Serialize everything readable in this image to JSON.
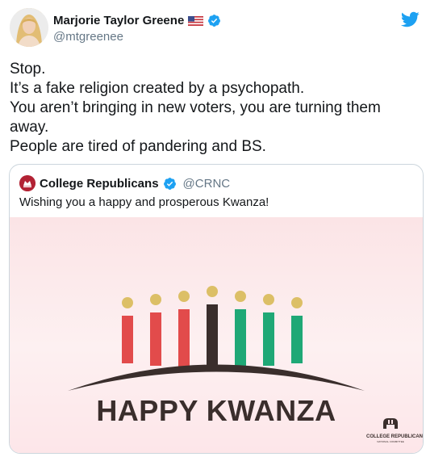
{
  "user": {
    "display_name": "Marjorie Taylor Greene",
    "handle": "@mtgreenee",
    "flag_icon": "us-flag-icon",
    "verified_icon": "verified-badge-icon",
    "verified_color": "#1da1f2"
  },
  "brand": {
    "icon": "twitter-bird-icon",
    "color": "#1da1f2"
  },
  "tweet": {
    "lines": [
      "Stop.",
      "It’s a fake religion created by a psychopath.",
      "You aren’t bringing in new voters, you are turning them away.",
      "People are tired of pandering and BS."
    ]
  },
  "quoted": {
    "display_name": "College Republicans",
    "handle": "@CRNC",
    "text": "Wishing you a happy and prosperous Kwanza!",
    "image": {
      "headline": "HAPPY KWANZA",
      "logo_text": "COLLEGE REPUBLICAN",
      "logo_subtext": "NATIONAL COMMITTEE",
      "candle_colors": [
        "#e24b4b",
        "#e24b4b",
        "#e24b4b",
        "#3a2e2c",
        "#1fa876",
        "#1fa876",
        "#1fa876"
      ],
      "flame_color": "#dcbf66",
      "base_color": "#3a2e2c"
    }
  }
}
